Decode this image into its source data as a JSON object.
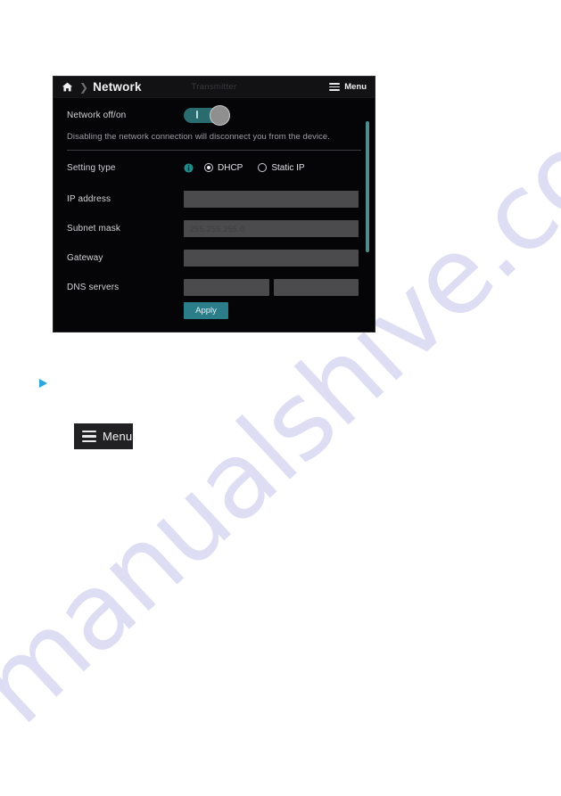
{
  "watermark": {
    "text": "manualshive.com",
    "color": "#c9c9ee"
  },
  "device_panel": {
    "header": {
      "home_icon": "home-icon",
      "breadcrumb_separator": "❯",
      "title": "Network",
      "subtitle": "Transmitter",
      "menu_icon": "hamburger-icon",
      "menu_label": "Menu"
    },
    "network_toggle": {
      "label": "Network off/on",
      "state": "on",
      "track_color": "#2a6b70",
      "knob_color": "#8f8f90"
    },
    "hint": "Disabling the network connection will disconnect you from the device.",
    "setting_type": {
      "label": "Setting type",
      "info_icon": "info-icon",
      "info_color": "#1f8b8b",
      "options": [
        {
          "label": "DHCP",
          "selected": true
        },
        {
          "label": "Static IP",
          "selected": false
        }
      ]
    },
    "fields": [
      {
        "label": "IP address",
        "value": "",
        "placeholder": ""
      },
      {
        "label": "Subnet mask",
        "value": "",
        "placeholder": "255.255.255.0"
      },
      {
        "label": "Gateway",
        "value": "",
        "placeholder": ""
      }
    ],
    "dns": {
      "label": "DNS servers",
      "primary": {
        "value": "",
        "placeholder": ""
      },
      "secondary": {
        "value": "",
        "placeholder": ""
      }
    },
    "apply_button": {
      "label": "Apply",
      "color": "#2b7d8a"
    },
    "scrollbar": {
      "thumb_color": "#4f8d8d"
    }
  },
  "bullet_marker": {
    "icon": "triangle-right-icon",
    "color": "#2aa6e0"
  },
  "inline_menu_chip": {
    "icon": "hamburger-icon",
    "label": "Menu",
    "background": "#212124"
  }
}
